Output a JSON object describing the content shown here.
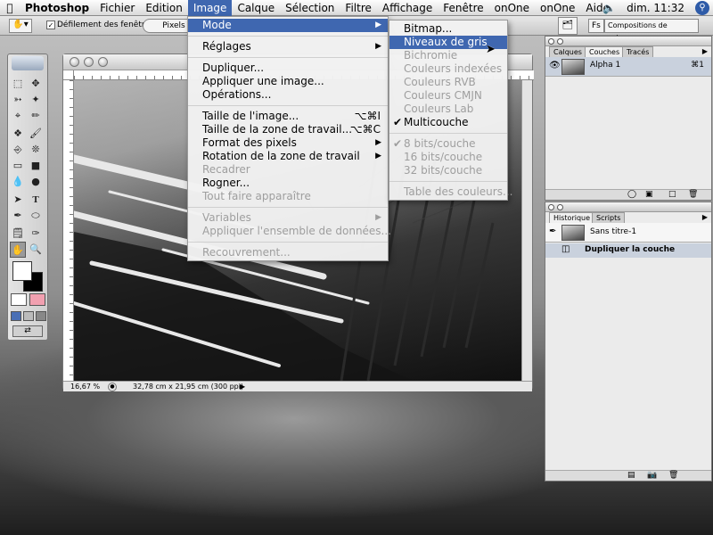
{
  "menubar": {
    "app": "Photoshop",
    "items": [
      "Fichier",
      "Edition",
      "Image",
      "Calque",
      "Sélection",
      "Filtre",
      "Affichage",
      "Fenêtre",
      "onOne",
      "onOne",
      "Aide"
    ],
    "active": "Image",
    "clock": "dim. 11:32"
  },
  "options": {
    "checkbox_label": "Défilement des fenêtres",
    "btn1": "Pixels",
    "btn2": "Fs",
    "btn3": "Compositions de calques"
  },
  "image_menu": [
    {
      "label": "Mode",
      "arrow": true,
      "highlight": true
    },
    {
      "sep": true
    },
    {
      "label": "Réglages",
      "arrow": true
    },
    {
      "sep": true
    },
    {
      "label": "Dupliquer..."
    },
    {
      "label": "Appliquer une image..."
    },
    {
      "label": "Opérations..."
    },
    {
      "sep": true
    },
    {
      "label": "Taille de l'image...",
      "shortcut": "⌥⌘I"
    },
    {
      "label": "Taille de la zone de travail...",
      "shortcut": "⌥⌘C"
    },
    {
      "label": "Format des pixels",
      "arrow": true
    },
    {
      "label": "Rotation de la zone de travail",
      "arrow": true
    },
    {
      "label": "Recadrer",
      "disabled": true
    },
    {
      "label": "Rogner..."
    },
    {
      "label": "Tout faire apparaître",
      "disabled": true
    },
    {
      "sep": true
    },
    {
      "label": "Variables",
      "arrow": true,
      "disabled": true
    },
    {
      "label": "Appliquer l'ensemble de données...",
      "disabled": true
    },
    {
      "sep": true
    },
    {
      "label": "Recouvrement...",
      "disabled": true
    }
  ],
  "mode_menu": [
    {
      "label": "Bitmap..."
    },
    {
      "label": "Niveaux de gris",
      "highlight": true
    },
    {
      "label": "Bichromie",
      "disabled": true
    },
    {
      "label": "Couleurs indexées",
      "disabled": true
    },
    {
      "label": "Couleurs RVB",
      "disabled": true
    },
    {
      "label": "Couleurs CMJN",
      "disabled": true
    },
    {
      "label": "Couleurs Lab",
      "disabled": true
    },
    {
      "label": "Multicouche",
      "checked": true
    },
    {
      "sep": true
    },
    {
      "label": "8 bits/couche",
      "checked": true,
      "disabled": true
    },
    {
      "label": "16 bits/couche",
      "disabled": true
    },
    {
      "label": "32 bits/couche",
      "disabled": true
    },
    {
      "sep": true
    },
    {
      "label": "Table des couleurs...",
      "disabled": true
    }
  ],
  "layers_panel": {
    "tabs": [
      "Calques",
      "Couches",
      "Tracés"
    ],
    "active_tab": "Couches",
    "channel_name": "Alpha 1",
    "channel_shortcut": "⌘1"
  },
  "history_panel": {
    "tabs": [
      "Historique",
      "Scripts"
    ],
    "active_tab": "Historique",
    "snapshot": "Sans titre-1",
    "step": "Dupliquer la couche"
  },
  "document": {
    "zoom": "16,67 %",
    "info": "32,78 cm x 21,95 cm (300 ppi)"
  },
  "colors": {
    "accent": "#3f67b0"
  }
}
